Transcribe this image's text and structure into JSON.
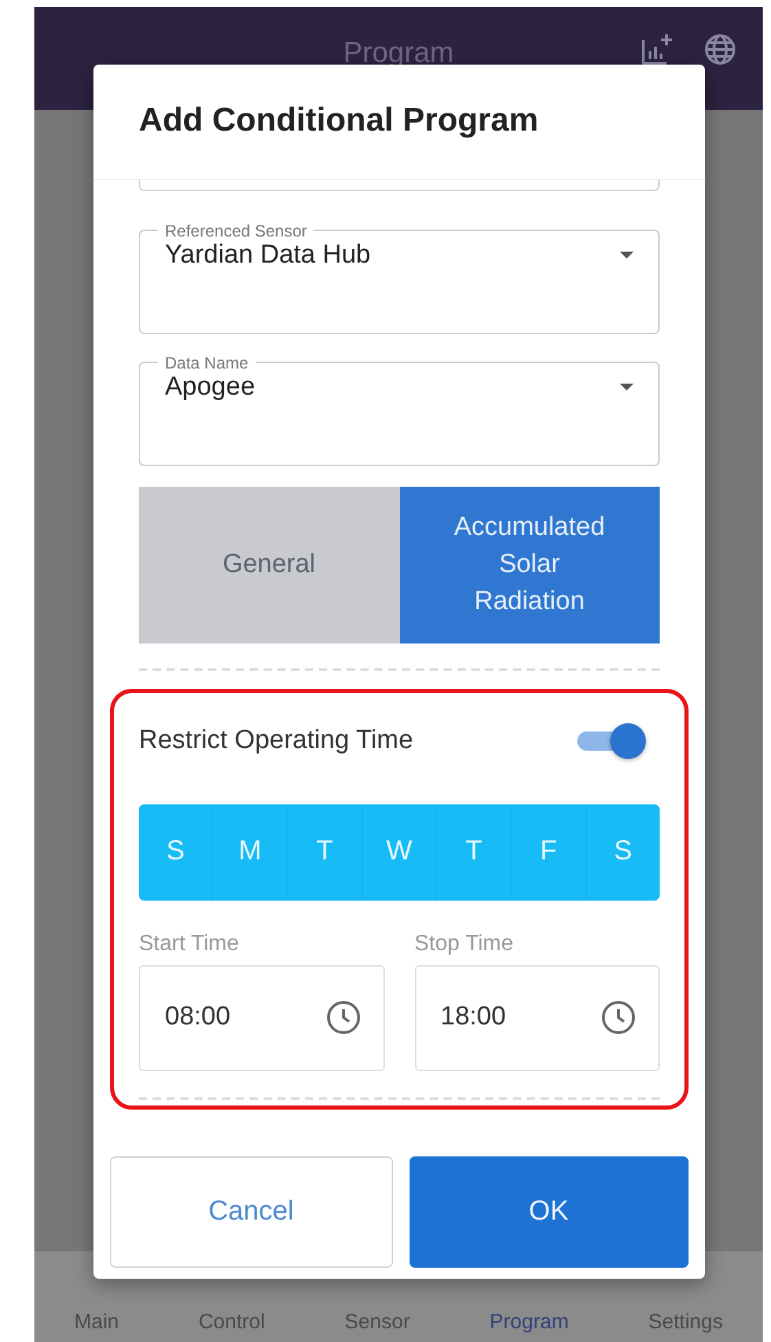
{
  "app_bar": {
    "title": "Program"
  },
  "dialog": {
    "title": "Add Conditional Program",
    "selects": [
      {
        "label": "Referenced Sensor",
        "value": "Yardian Data Hub"
      },
      {
        "label": "Data Name",
        "value": "Apogee"
      }
    ],
    "segments": [
      {
        "label": "General",
        "selected": false
      },
      {
        "label": "Accumulated Solar Radiation",
        "selected": true
      }
    ],
    "restrict": {
      "label": "Restrict Operating Time",
      "on": true,
      "days": [
        {
          "label": "S",
          "selected": true
        },
        {
          "label": "M",
          "selected": true
        },
        {
          "label": "T",
          "selected": true
        },
        {
          "label": "W",
          "selected": true
        },
        {
          "label": "T",
          "selected": true
        },
        {
          "label": "F",
          "selected": true
        },
        {
          "label": "S",
          "selected": true
        }
      ],
      "times": [
        {
          "label": "Start Time",
          "value": "08:00"
        },
        {
          "label": "Stop Time",
          "value": "18:00"
        }
      ]
    },
    "buttons": [
      {
        "label": "Cancel",
        "kind": "outlined"
      },
      {
        "label": "OK",
        "kind": "primary"
      }
    ]
  },
  "bottom_nav": [
    {
      "label": "Main",
      "selected": false
    },
    {
      "label": "Control",
      "selected": false
    },
    {
      "label": "Sensor",
      "selected": false
    },
    {
      "label": "Program",
      "selected": true
    },
    {
      "label": "Settings",
      "selected": false
    }
  ]
}
